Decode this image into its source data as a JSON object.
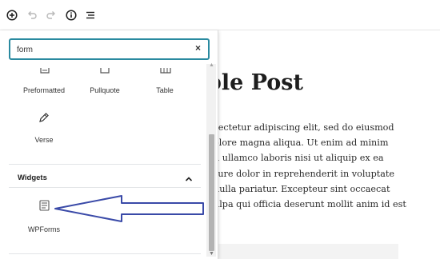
{
  "toolbar": {
    "add_block_icon": "plus-circle-icon",
    "undo_icon": "undo-icon",
    "redo_icon": "redo-icon",
    "info_icon": "info-icon",
    "outline_icon": "list-view-icon"
  },
  "inserter": {
    "search": {
      "value": "form",
      "placeholder": "",
      "clear_label": "×"
    },
    "blocks": [
      {
        "label": "Preformatted",
        "icon": "preformatted-icon"
      },
      {
        "label": "Pullquote",
        "icon": "pullquote-icon"
      },
      {
        "label": "Table",
        "icon": "table-icon"
      },
      {
        "label": "Verse",
        "icon": "pencil-icon"
      }
    ],
    "widgets": {
      "title": "Widgets",
      "expanded": true,
      "items": [
        {
          "label": "WPForms",
          "icon": "wpforms-icon"
        }
      ]
    }
  },
  "editor": {
    "title_visible": "ple Post",
    "paragraph_lines": [
      "sectetur adipiscing elit, sed do eiusmod",
      "olore magna aliqua. Ut enim ad minim",
      "n ullamco laboris nisi ut aliquip ex ea",
      "rure dolor in reprehenderit in voluptate",
      "nulla pariatur. Excepteur sint occaecat",
      "ulpa qui officia deserunt mollit anim id est"
    ]
  },
  "colors": {
    "search_border": "#2a8aa0",
    "annotation_arrow": "#3a4aa8",
    "scroll_thumb": "#b3b3b3"
  }
}
